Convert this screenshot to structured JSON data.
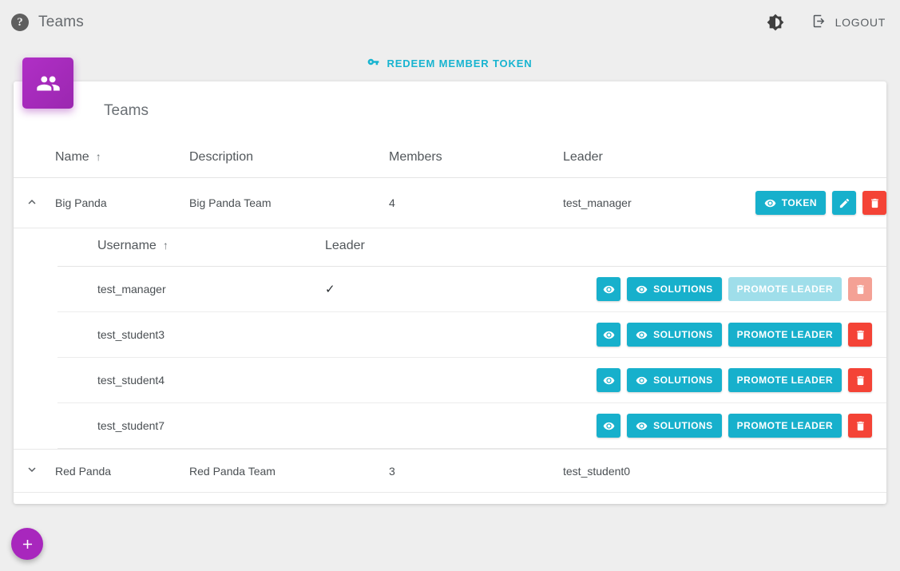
{
  "topbar": {
    "help_icon": "help-circle-icon",
    "title": "Teams",
    "theme_toggle_icon": "brightness-contrast-icon",
    "logout_icon": "logout-icon",
    "logout_label": "LOGOUT"
  },
  "redeem": {
    "icon": "key-icon",
    "label": "REDEEM MEMBER TOKEN"
  },
  "card": {
    "badge_icon": "people-group-icon",
    "title": "Teams"
  },
  "teams_table": {
    "headers": {
      "name": "Name",
      "description": "Description",
      "members": "Members",
      "leader": "Leader",
      "sort_arrow": "↑"
    },
    "rows": [
      {
        "expanded": true,
        "chevron": "˄",
        "name": "Big Panda",
        "description": "Big Panda Team",
        "members": "4",
        "leader": "test_manager",
        "actions": {
          "token_label": "TOKEN",
          "token_icon": "eye-icon",
          "edit_icon": "pencil-icon",
          "delete_icon": "trash-icon"
        },
        "members_table": {
          "headers": {
            "username": "Username",
            "leader": "Leader",
            "sort_arrow": "↑"
          },
          "rows": [
            {
              "username": "test_manager",
              "is_leader": "✓",
              "view_icon": "eye-icon",
              "solutions_icon": "eye-icon",
              "solutions_label": "SOLUTIONS",
              "promote_label": "PROMOTE LEADER",
              "promote_disabled": true,
              "delete_icon": "trash-icon",
              "delete_disabled": true
            },
            {
              "username": "test_student3",
              "is_leader": "",
              "view_icon": "eye-icon",
              "solutions_icon": "eye-icon",
              "solutions_label": "SOLUTIONS",
              "promote_label": "PROMOTE LEADER",
              "promote_disabled": false,
              "delete_icon": "trash-icon",
              "delete_disabled": false
            },
            {
              "username": "test_student4",
              "is_leader": "",
              "view_icon": "eye-icon",
              "solutions_icon": "eye-icon",
              "solutions_label": "SOLUTIONS",
              "promote_label": "PROMOTE LEADER",
              "promote_disabled": false,
              "delete_icon": "trash-icon",
              "delete_disabled": false
            },
            {
              "username": "test_student7",
              "is_leader": "",
              "view_icon": "eye-icon",
              "solutions_icon": "eye-icon",
              "solutions_label": "SOLUTIONS",
              "promote_label": "PROMOTE LEADER",
              "promote_disabled": false,
              "delete_icon": "trash-icon",
              "delete_disabled": false
            }
          ]
        }
      },
      {
        "expanded": false,
        "chevron": "˅",
        "name": "Red Panda",
        "description": "Red Panda Team",
        "members": "3",
        "leader": "test_student0",
        "actions": null,
        "members_table": null
      }
    ]
  },
  "fab": {
    "icon": "plus-icon",
    "label": "+"
  },
  "colors": {
    "page_background": "#eeeeee",
    "card_background": "#ffffff",
    "accent_purple": "#a827bd",
    "accent_cyan": "#17b0cc",
    "danger_red": "#f44336",
    "link_cyan": "#18b4d0",
    "disabled_cyan": "#9fdeea",
    "disabled_red": "#f4a195"
  }
}
